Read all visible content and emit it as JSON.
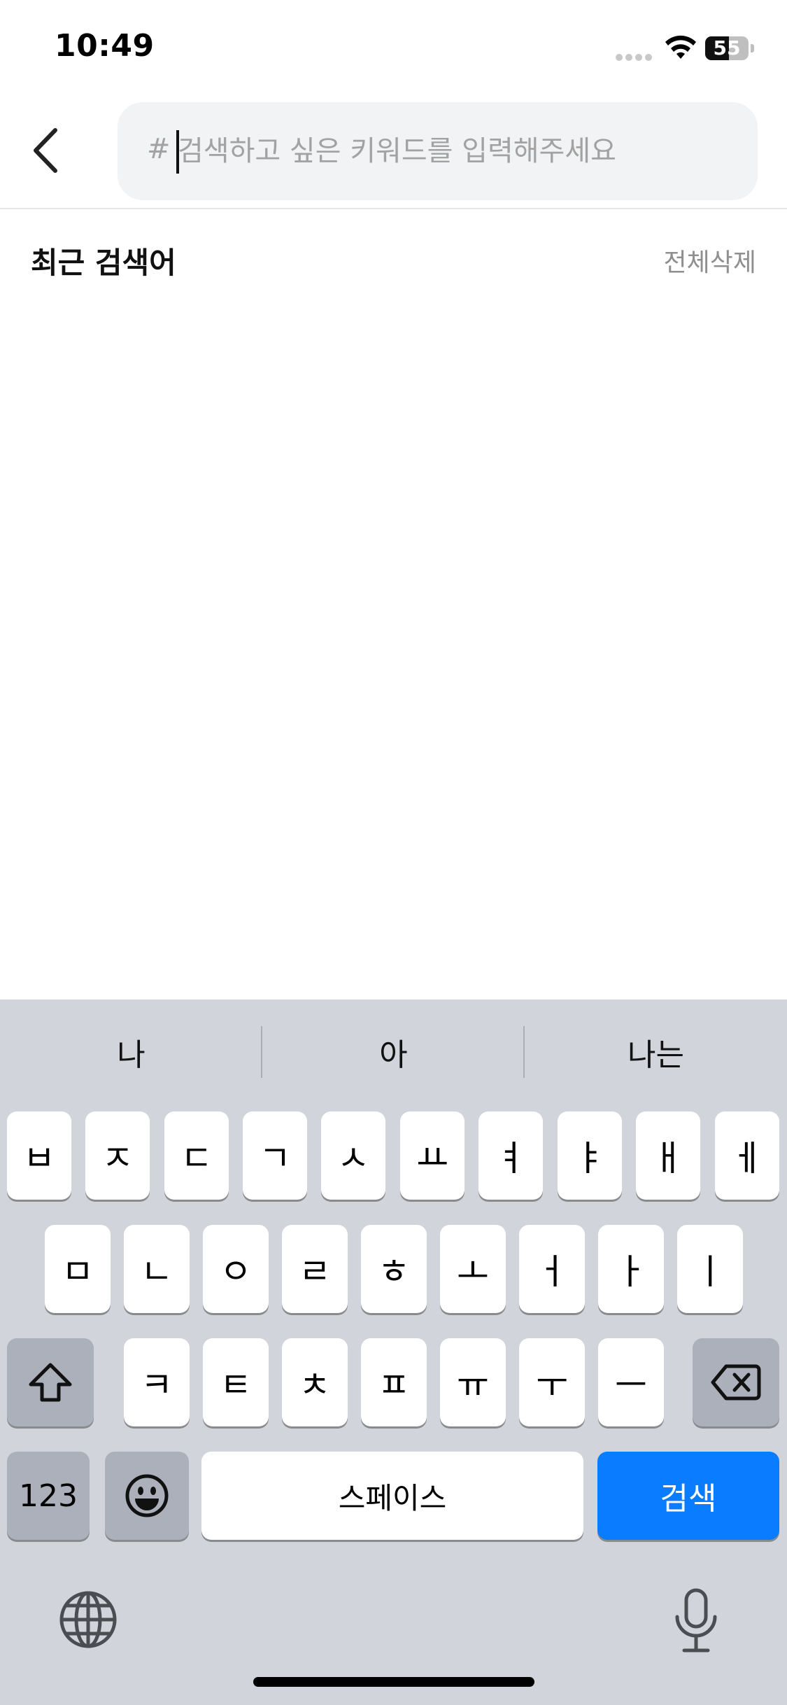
{
  "status_bar": {
    "time": "10:49",
    "battery": "55",
    "battery_level_percent": 55
  },
  "search": {
    "hash": "#",
    "placeholder": "검색하고 싶은 키워드를 입력해주세요",
    "value": ""
  },
  "recent": {
    "title": "최근 검색어",
    "clear_all": "전체삭제"
  },
  "keyboard": {
    "suggestions": [
      "나",
      "아",
      "나는"
    ],
    "row1": [
      "ㅂ",
      "ㅈ",
      "ㄷ",
      "ㄱ",
      "ㅅ",
      "ㅛ",
      "ㅕ",
      "ㅑ",
      "ㅐ",
      "ㅔ"
    ],
    "row2": [
      "ㅁ",
      "ㄴ",
      "ㅇ",
      "ㄹ",
      "ㅎ",
      "ㅗ",
      "ㅓ",
      "ㅏ",
      "ㅣ"
    ],
    "row3": [
      "ㅋ",
      "ㅌ",
      "ㅊ",
      "ㅍ",
      "ㅠ",
      "ㅜ",
      "ㅡ"
    ],
    "numbers_label": "123",
    "space_label": "스페이스",
    "search_label": "검색",
    "icons": {
      "shift": "shift-icon",
      "backspace": "backspace-icon",
      "emoji": "emoji-icon",
      "globe": "globe-icon",
      "mic": "microphone-icon"
    },
    "accent_color": "#0a7cff"
  }
}
